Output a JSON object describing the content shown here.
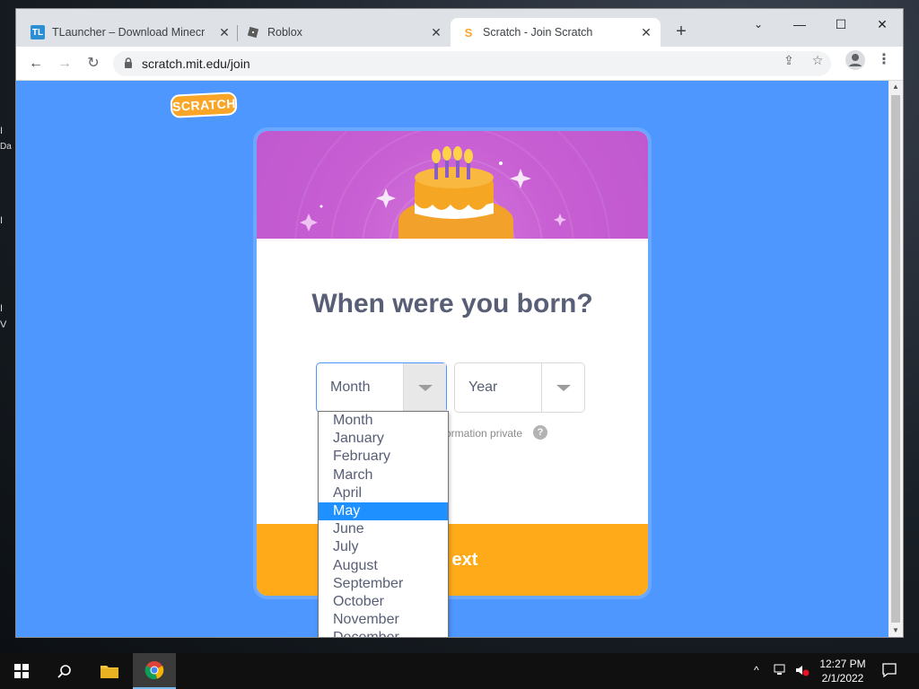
{
  "browser": {
    "tabs": [
      {
        "title": "TLauncher – Download Minecraft",
        "favicon_text": "TL",
        "favicon_color": "#2c8fd6"
      },
      {
        "title": "Roblox",
        "favicon_text": "",
        "favicon_color": "#5a5a5a"
      },
      {
        "title": "Scratch - Join Scratch",
        "favicon_text": "S",
        "favicon_color": "#f9a628",
        "active": true
      }
    ],
    "url": "scratch.mit.edu/join"
  },
  "desktop": {
    "left_labels": [
      "I",
      "Da",
      "I",
      "I",
      "V"
    ]
  },
  "page": {
    "logo_text": "SCRATCH",
    "heading": "When were you born?",
    "month_select": {
      "value": "Month"
    },
    "year_select": {
      "value": "Year"
    },
    "privacy_text": "ormation private",
    "help_icon": "?",
    "next_label": "ext",
    "month_options": [
      "Month",
      "January",
      "February",
      "March",
      "April",
      "May",
      "June",
      "July",
      "August",
      "September",
      "October",
      "November",
      "December"
    ],
    "highlighted_option": "May"
  },
  "colors": {
    "page_bg": "#4d97ff",
    "banner": "#c85fd3",
    "next_bar": "#ffab19",
    "heading": "#575e75",
    "highlight": "#1e90ff"
  },
  "taskbar": {
    "time": "12:27 PM",
    "date": "2/1/2022"
  }
}
